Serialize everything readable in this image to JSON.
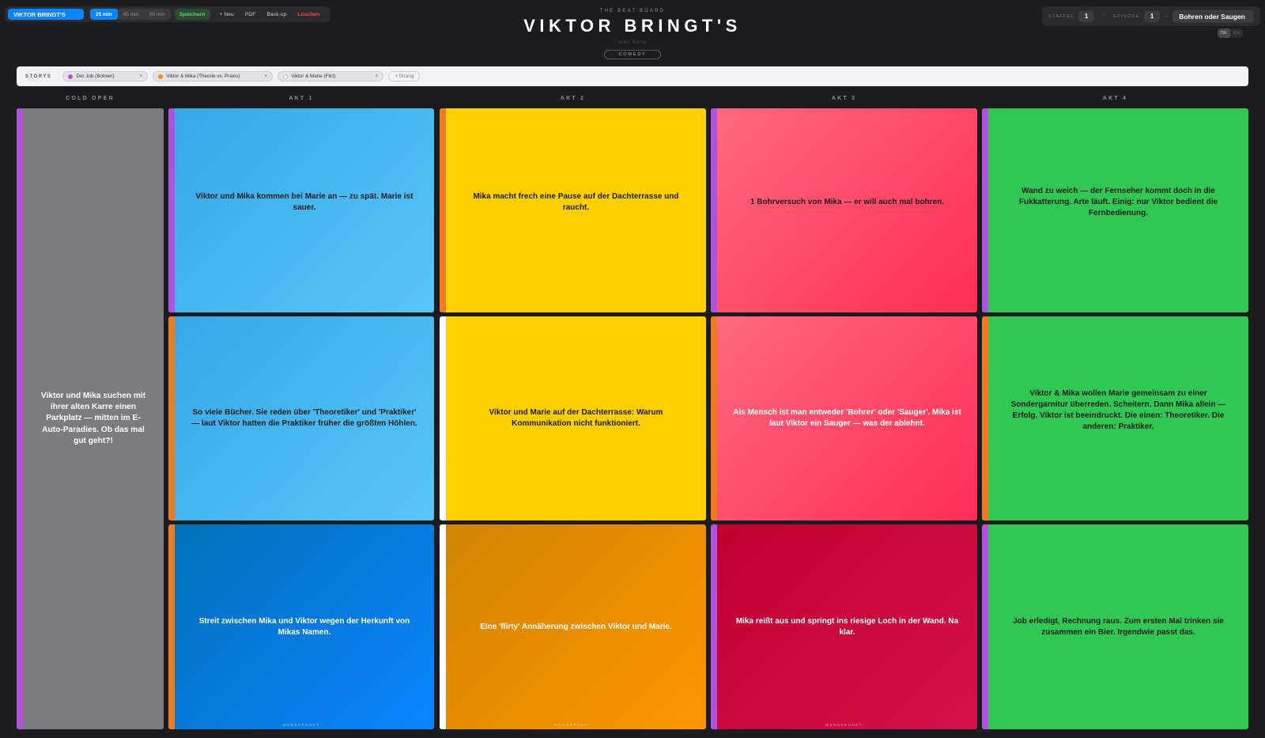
{
  "toolbar": {
    "project": "VIKTOR BRINGT'S",
    "lengths": [
      "25 min",
      "45 min",
      "60 min"
    ],
    "active_length": "25 min",
    "save_label": "Speichern",
    "new_label": "+ Neu",
    "pdf_label": "PDF",
    "backup_label": "Back-up",
    "delete_label": "Löschen"
  },
  "header": {
    "overline": "THE BEAT BOARD",
    "title": "VIKTOR BRINGT'S",
    "subtitle": "eine Serie",
    "genre": "COMEDY"
  },
  "meta": {
    "season_label": "STAFFEL",
    "season": "1",
    "episode_label": "EPISODE",
    "episode": "1",
    "episode_title": "Bohren oder Saugen",
    "separator": "/",
    "dots": "—",
    "languages": [
      "DE",
      "EN"
    ],
    "active_language": "DE"
  },
  "storys": {
    "label": "STORYS",
    "strands": [
      {
        "label": "Der Job (Bohren)",
        "color": "#af52de"
      },
      {
        "label": "Viktor & Mika (Theorie vs. Praxis)",
        "color": "#ff8a1f"
      },
      {
        "label": "Viktor & Marie (Flirt)",
        "color": "#ffffff"
      }
    ],
    "add_label": "+ Strang",
    "remove_symbol": "×"
  },
  "columns": {
    "cold_open": "COLD OPEN",
    "akt1": "AKT 1",
    "akt2": "AKT 2",
    "akt3": "AKT 3",
    "akt4": "AKT 4"
  },
  "colors": {
    "strand_job": "#af52de",
    "strand_mika": "#f07a1f",
    "strand_marie": "#ffffff",
    "blue_light": "#38aaea",
    "blue_deep": "#0a7fe8",
    "yellow": "#ffcf00",
    "orange": "#f08c00",
    "pink": "#ff4a68",
    "crimson": "#c8003a",
    "green": "#30c752",
    "gray": "#7c7b80"
  },
  "cards": {
    "cold_open": "Viktor und Mika suchen mit ihrer alten Karre einen Parkplatz — mitten im E-Auto-Paradies. Ob das mal gut geht?!",
    "a1r1": "Viktor und Mika kommen bei Marie an — zu spät. Marie ist sauer.",
    "a1r2": "So viele Bücher. Sie reden über 'Theoretiker' und 'Praktiker' — laut Viktor hatten die Praktiker früher die größten Höhlen.",
    "a1r3": "Streit zwischen Mika und Viktor wegen der Herkunft von Mikas Namen.",
    "a2r1": "Mika macht frech eine Pause auf der Dachterrasse und raucht.",
    "a2r2": "Viktor und Marie auf der Dachterrasse: Warum Kommunikation nicht funktioniert.",
    "a2r3": "Eine 'flirty' Annäherung zwischen Viktor und Marie.",
    "a3r1": "1 Bohrversuch von Mika — er will auch mal bohren.",
    "a3r2": "Als Mensch ist man entweder 'Bohrer' oder 'Sauger'. Mika ist laut Viktor ein Sauger — was der ablehnt.",
    "a3r3": "Mika reißt aus und springt ins riesige Loch in der Wand. Na klar.",
    "a4r1": "Wand zu weich — der Fernseher kommt doch in die Fukkatterung. Arte läuft. Einig: nur Viktor bedient die Fernbedienung.",
    "a4r2": "Viktor & Mika wollen Marie gemeinsam zu einer Sondergarnitur überreden. Scheitern. Dann Mika allein — Erfolg. Viktor ist beeindruckt. Die einen: Theoretiker. Die anderen: Praktiker.",
    "a4r3": "Job erledigt, Rechnung raus. Zum ersten Mal trinken sie zusammen ein Bier. Irgendwie passt das.",
    "wendepunkt": "WENDEPUNKT"
  }
}
